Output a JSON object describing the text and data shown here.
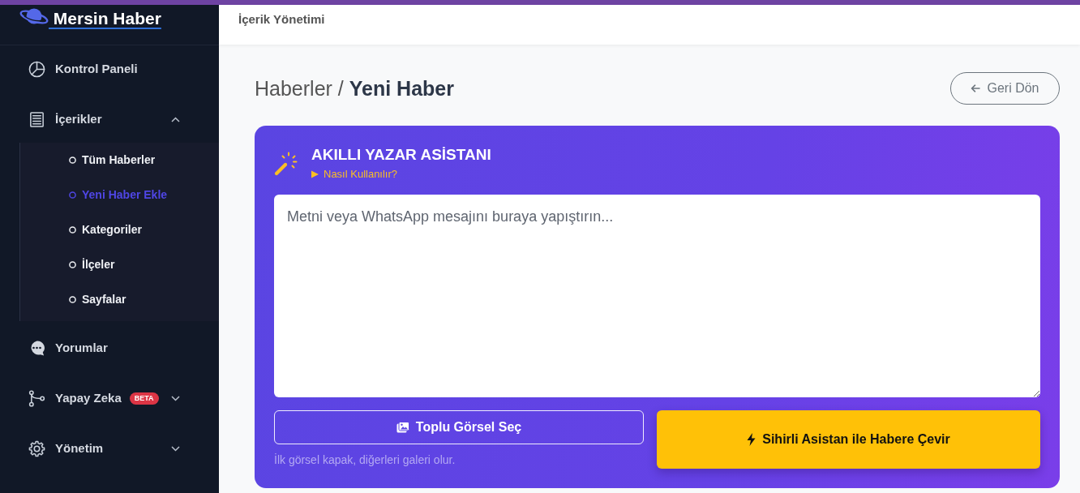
{
  "sidebar": {
    "brand": "Mersin Haber",
    "items": [
      {
        "label": "Kontrol Paneli",
        "kind": "link"
      },
      {
        "label": "İçerikler",
        "kind": "group",
        "expanded": true,
        "children": [
          {
            "label": "Tüm Haberler",
            "selected": false
          },
          {
            "label": "Yeni Haber Ekle",
            "selected": true
          },
          {
            "label": "Kategoriler",
            "selected": false
          },
          {
            "label": "İlçeler",
            "selected": false
          },
          {
            "label": "Sayfalar",
            "selected": false
          }
        ]
      },
      {
        "label": "Yorumlar",
        "kind": "link"
      },
      {
        "label": "Yapay Zeka",
        "kind": "group",
        "expanded": false,
        "badge": "BETA"
      },
      {
        "label": "Yönetim",
        "kind": "group",
        "expanded": false
      }
    ]
  },
  "header": {
    "title": "İçerik Yönetimi"
  },
  "page": {
    "title": "Haberler / **Yeni Haber**",
    "back_button": "Geri Dön"
  },
  "assistant": {
    "title": "AKILLI YAZAR ASİSTANI",
    "help": {
      "label": "Nasıl Kullanılır?",
      "expanded": false
    },
    "input": {
      "placeholder": "Metni veya WhatsApp mesajını buraya yapıştırın..."
    },
    "image_button": "Toplu Görsel Seç",
    "image_hint": "İlk görsel kapak, diğerleri galeri olur.",
    "convert_button": "Sihirli Asistan ile Habere Çevir"
  }
}
